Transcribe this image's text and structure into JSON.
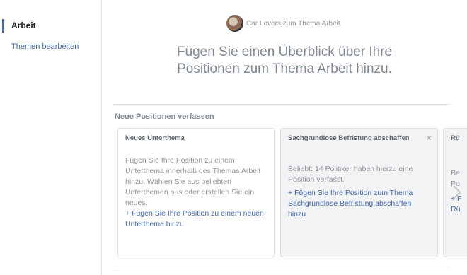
{
  "sidebar": {
    "active_item": "Arbeit",
    "edit_link": "Themen bearbeiten"
  },
  "header": {
    "subtitle": "Car Lovers zum Thema Arbeit",
    "headline_line1": "Fügen Sie einen Überblick über Ihre",
    "headline_line2": "Positionen zum Thema Arbeit hinzu."
  },
  "section": {
    "title": "Neue Positionen verfassen"
  },
  "cards": [
    {
      "title": "Neues Unterthema",
      "text": "Fügen Sie Ihre Position zu einem Unterthema innerhalb des Themas Arbeit hinzu. Wählen Sie aus beliebten Unterthemen aus oder erstellen Sie ein neues.",
      "link": "+ Fügen Sie Ihre Position zu einem neuen Unterthema hinzu"
    },
    {
      "title": "Sachgrundlose Befristung abschaffen",
      "close": "×",
      "text": "Beliebt: 14 Politiker haben hierzu eine Position verfasst.",
      "link": "+ Fügen Sie Ihre Position zum Thema Sachgrundlose Befristung abschaffen hinzu"
    },
    {
      "title": "Rü",
      "text_line1": "Be",
      "text_line2": "Po",
      "link_line1": "+ F",
      "link_line2": "Rü"
    }
  ],
  "icons": {
    "avatar": "avatar-image",
    "next": "chevron-right-icon",
    "close": "close-icon"
  },
  "colors": {
    "accent": "#4267b2",
    "muted_text": "#90949c",
    "card_grey": "#f2f3f5"
  }
}
